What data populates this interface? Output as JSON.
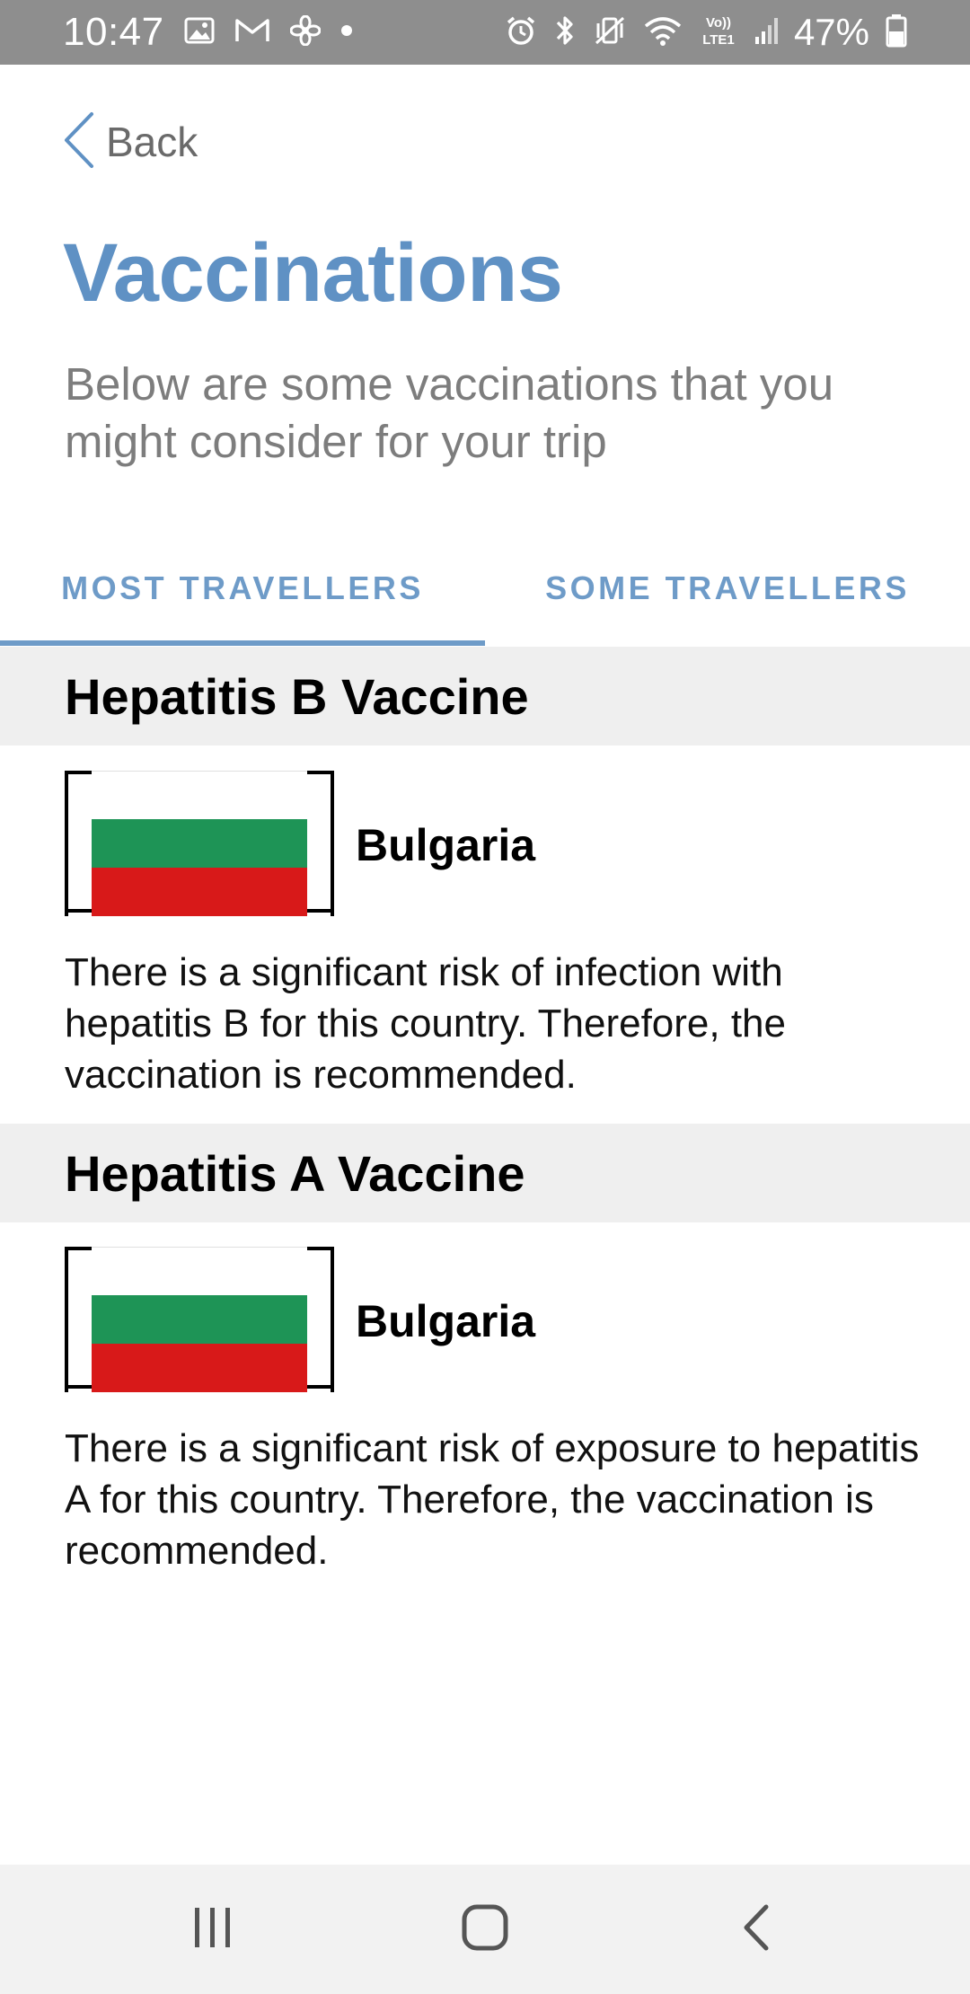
{
  "status_bar": {
    "time": "10:47",
    "battery": "47%",
    "network": "Vo) LTE1"
  },
  "header": {
    "back_label": "Back"
  },
  "page": {
    "title": "Vaccinations",
    "subtitle": "Below are some vaccinations that you might consider for your trip"
  },
  "tabs": [
    {
      "label": "MOST TRAVELLERS",
      "active": true
    },
    {
      "label": "SOME TRAVELLERS",
      "active": false
    }
  ],
  "vaccines": [
    {
      "name": "Hepatitis B Vaccine",
      "country": "Bulgaria",
      "description": "There is a significant risk of infection with hepatitis B for this country. Therefore, the vaccination is recommended."
    },
    {
      "name": "Hepatitis A Vaccine",
      "country": "Bulgaria",
      "description": "There is a significant risk of exposure to hepatitis A for this country. Therefore, the vaccination is recommended."
    }
  ],
  "colors": {
    "accent": "#5f91c4",
    "tab": "#6e9bc8",
    "section_bg": "#efefef",
    "flag_white": "#ffffff",
    "flag_green": "#1e9456",
    "flag_red": "#d81919"
  },
  "icons": {
    "back": "chevron-left-icon",
    "nav_recents": "recents-icon",
    "nav_home": "home-icon",
    "nav_back": "back-icon"
  }
}
